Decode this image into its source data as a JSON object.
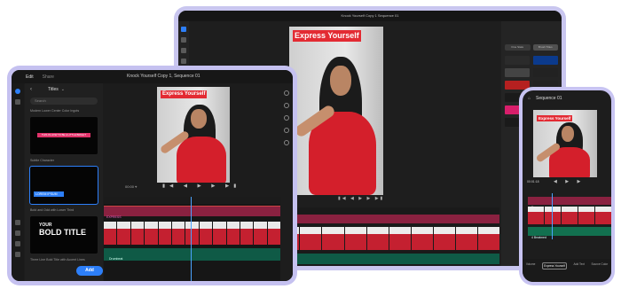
{
  "laptop": {
    "window_title": "Knock Yourself Copy 1 Sequence 01",
    "video_caption": "Express Yourself",
    "right_panel": {
      "btn1": "Fine Stats",
      "btn2": "Brush Titles"
    },
    "controls": "▮◀ ◀ ▶ ▶ ▶▮"
  },
  "tablet": {
    "tabs": [
      "Edit",
      "Share"
    ],
    "title": "Knock Yourself Copy 1, Sequence 01",
    "panel_title": "Titles",
    "search_placeholder": "Search",
    "items": [
      {
        "label": "Modern Lower Center Color Ingots",
        "thumb_text": "THIS IS HOW TO BE A LITTLE BRIGHT"
      },
      {
        "label": "Subtle Character",
        "thumb_text": "LOREM IPSUM"
      },
      {
        "label": "Bold and Odd with Lower Third",
        "thumb_text_1": "YOUR",
        "thumb_text_2": "BOLD TITLE"
      },
      {
        "label": "Three Line Bold Title with Accent Lines"
      }
    ],
    "add_button": "Add",
    "timecode": "00:00 ⌖",
    "video_caption": "Express Yourself",
    "controls": "▮◀ ◀ ▶ ▶ ▶▮",
    "timeline": {
      "text_track": "EXPRESS",
      "audio_track": "Drumbeat",
      "meta": [
        "V1",
        "V2",
        "A1"
      ]
    }
  },
  "phone": {
    "title": "Sequence 01",
    "video_caption": "Express Yourself",
    "timecode": "00:01:18",
    "controls": "◀ ▶ ▶",
    "text_track": "Express",
    "audio_track": "4 Beatmed",
    "bottom": [
      {
        "label": "Volume"
      },
      {
        "label": "Express Yourself",
        "selected": true
      },
      {
        "label": "Add Text"
      },
      {
        "label": "Source Color"
      }
    ]
  }
}
